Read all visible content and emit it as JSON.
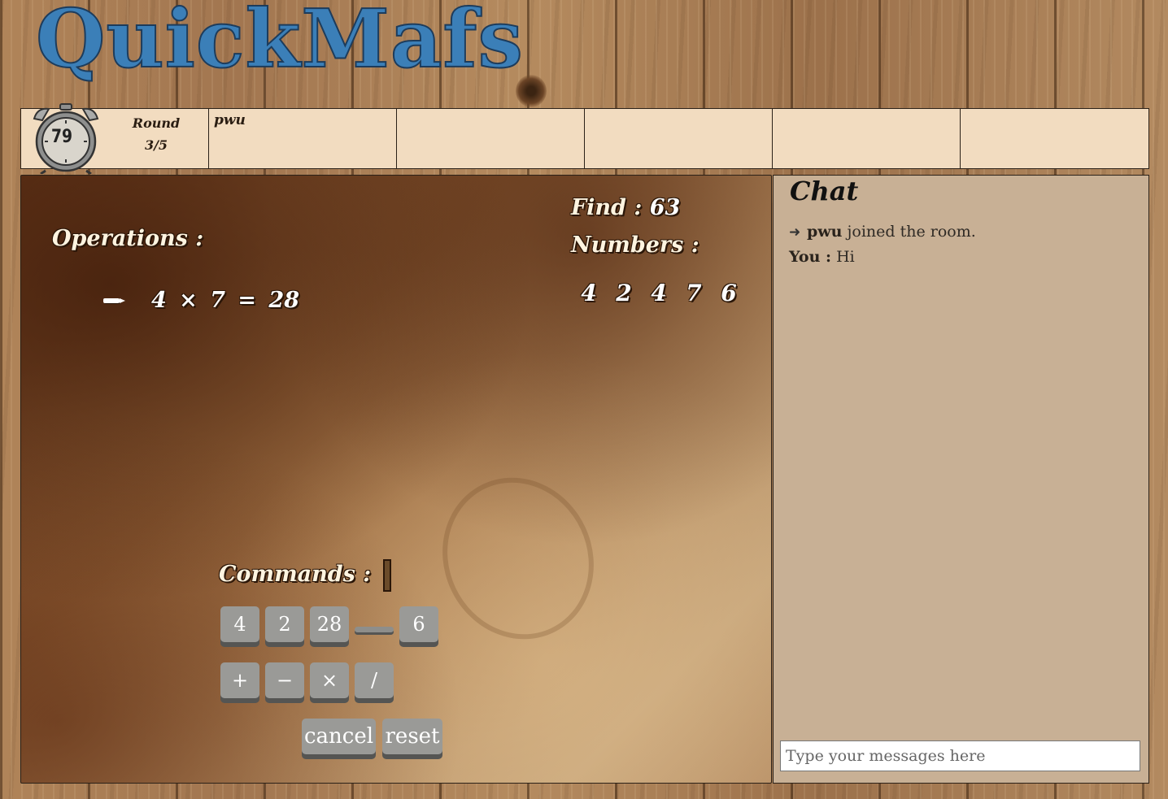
{
  "header": {
    "logo_part1": "Quick",
    "logo_part2": "M",
    "logo_part3": "afs"
  },
  "scoreboard": {
    "timer_value": "79",
    "round_label": "Round",
    "round_value": "3/5",
    "players": [
      "pwu",
      "",
      "",
      "",
      ""
    ]
  },
  "game": {
    "operations_label": "Operations :",
    "operations": [
      {
        "icon": "pencil-icon",
        "text": "4 × 7 = 28"
      }
    ],
    "find_label": "Find :",
    "find_value": "63",
    "numbers_label": "Numbers :",
    "numbers": [
      "4",
      "2",
      "4",
      "7",
      "6"
    ],
    "commands_label": "Commands :",
    "number_buttons": [
      "4",
      "2",
      "28",
      "",
      "6"
    ],
    "operator_buttons": [
      "+",
      "−",
      "×",
      "/"
    ],
    "cancel_label": "cancel",
    "reset_label": "reset"
  },
  "chat": {
    "title": "Chat",
    "messages": [
      {
        "type": "system",
        "icon": "arrow-right-icon",
        "user": "pwu",
        "text": "joined the room."
      },
      {
        "type": "user",
        "user": "You :",
        "text": "Hi"
      }
    ],
    "input_placeholder": "Type your messages here"
  },
  "colors": {
    "logo_blue": "#3b7fb8",
    "scorebar_bg": "#f2dcc0",
    "chat_bg": "#c8b095",
    "button_gray": "#9a9a97"
  }
}
